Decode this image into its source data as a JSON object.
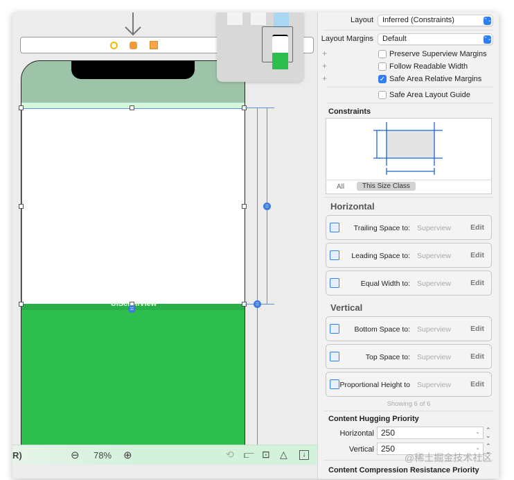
{
  "canvas": {
    "scroll_view_label": "UIScrollView",
    "zoom_level": "78%",
    "toolbar_left_text": "R)",
    "colors": {
      "top_safe_area": "#9dc4a9",
      "green_view": "#2ebd4f",
      "constraint": "#5b8fd8"
    }
  },
  "inspector": {
    "layout_label": "Layout",
    "layout_value": "Inferred (Constraints)",
    "margins_label": "Layout Margins",
    "margins_value": "Default",
    "checkboxes": [
      {
        "label": "Preserve Superview Margins",
        "checked": false
      },
      {
        "label": "Follow Readable Width",
        "checked": false
      },
      {
        "label": "Safe Area Relative Margins",
        "checked": true
      },
      {
        "label": "Safe Area Layout Guide",
        "checked": false
      }
    ],
    "constraints_title": "Constraints",
    "tabs": [
      "All",
      "This Size Class"
    ],
    "horizontal_title": "Horizontal",
    "vertical_title": "Vertical",
    "horizontal": [
      {
        "name": "Trailing Space to:",
        "target": "Superview",
        "action": "Edit"
      },
      {
        "name": "Leading Space to:",
        "target": "Superview",
        "action": "Edit"
      },
      {
        "name": "Equal Width to:",
        "target": "Superview",
        "action": "Edit"
      }
    ],
    "vertical": [
      {
        "name": "Bottom Space to:",
        "target": "Superview",
        "action": "Edit"
      },
      {
        "name": "Top Space to:",
        "target": "Superview",
        "action": "Edit"
      },
      {
        "name": "Proportional Height to",
        "target": "Superview",
        "action": "Edit"
      }
    ],
    "showing": "Showing 6 of 6",
    "hugging_title": "Content Hugging Priority",
    "hugging_horizontal_label": "Horizontal",
    "hugging_horizontal_value": "250",
    "hugging_vertical_label": "Vertical",
    "hugging_vertical_value": "250",
    "compression_title": "Content Compression Resistance Priority"
  },
  "watermark": "@稀土掘金技术社区"
}
